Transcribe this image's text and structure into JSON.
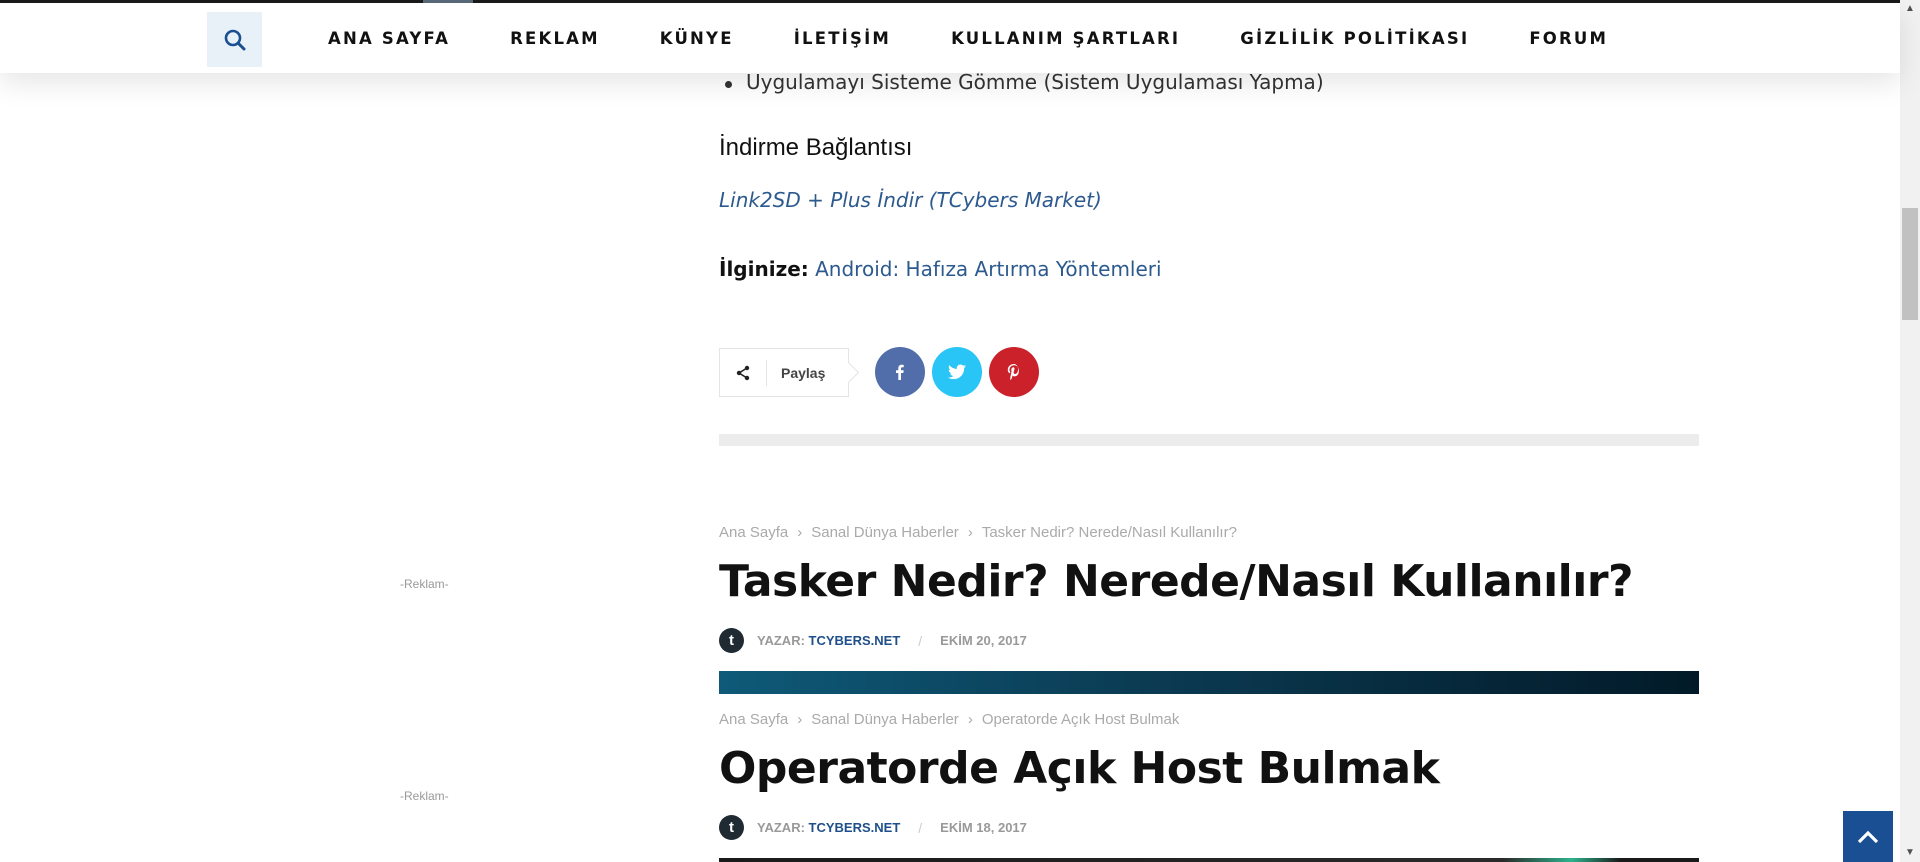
{
  "nav": {
    "items": [
      "ANA SAYFA",
      "REKLAM",
      "KÜNYE",
      "İLETİŞİM",
      "KULLANIM ŞARTLARI",
      "GİZLİLİK POLİTİKASI",
      "FORUM"
    ]
  },
  "article": {
    "bullet": "Uygulamayı Sisteme Gömme (Sistem Uygulaması Yapma)",
    "download_heading": "İndirme Bağlantısı",
    "download_link": "Link2SD + Plus İndir (TCybers Market)",
    "related_label": "İlginize:",
    "related_link": "Android: Hafıza Artırma Yöntemleri"
  },
  "share": {
    "label": "Paylaş",
    "networks": [
      "facebook",
      "twitter",
      "pinterest"
    ]
  },
  "posts": [
    {
      "breadcrumb": [
        "Ana Sayfa",
        "Sanal Dünya Haberler",
        "Tasker Nedir? Nerede/Nasıl Kullanılır?"
      ],
      "title": "Tasker Nedir? Nerede/Nasıl Kullanılır?",
      "author_prefix": "YAZAR:",
      "author": "TCYBERS.NET",
      "date": "EKİM 20, 2017"
    },
    {
      "breadcrumb": [
        "Ana Sayfa",
        "Sanal Dünya Haberler",
        "Operatorde Açık Host Bulmak"
      ],
      "title": "Operatorde Açık Host Bulmak",
      "author_prefix": "YAZAR:",
      "author": "TCYBERS.NET",
      "date": "EKİM 18, 2017"
    }
  ],
  "ads": [
    "-Reklam-",
    "-Reklam-"
  ],
  "colors": {
    "link": "#2d5a8e",
    "facebook": "#516eab",
    "twitter": "#29c5f6",
    "pinterest": "#ca212a",
    "scroll_top": "#1a4f93"
  }
}
